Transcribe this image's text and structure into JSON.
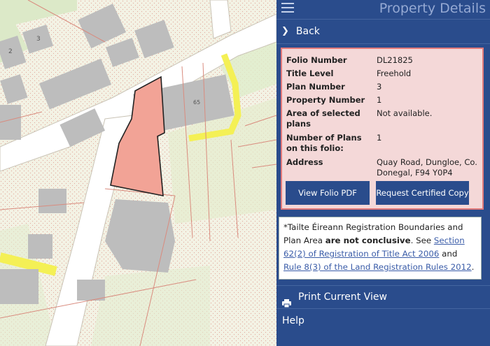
{
  "header": {
    "title": "Property Details",
    "menu_icon": "hamburger-icon"
  },
  "nav": {
    "back_label": "Back",
    "back_icon": "chevron-right-icon"
  },
  "details": {
    "rows": [
      {
        "label": "Folio Number",
        "value": "DL21825"
      },
      {
        "label": "Title Level",
        "value": "Freehold"
      },
      {
        "label": "Plan Number",
        "value": "3"
      },
      {
        "label": "Property Number",
        "value": "1"
      },
      {
        "label": "Area of selected plans",
        "value": "Not available."
      },
      {
        "label": "Number of Plans on this folio:",
        "value": "1"
      },
      {
        "label": "Address",
        "value": "Quay Road, Dungloe, Co. Donegal, F94 Y0P4"
      }
    ],
    "view_pdf_label": "View Folio PDF",
    "certified_copy_label": "Request Certified Copy"
  },
  "notice": {
    "prefix": "*Tailte Éireann Registration Boundaries and Plan Area ",
    "bold": "are not conclusive",
    "mid1": ". See ",
    "link1": "Section 62(2) of Registration of Title Act 2006",
    "mid2": " and ",
    "link2": "Rule 8(3) of the Land Registration Rules 2012",
    "suffix": "."
  },
  "actions": {
    "print_label": "Print Current View",
    "print_icon": "printer-icon",
    "help_label": "Help"
  },
  "map": {
    "labels": [
      "2",
      "3",
      "65"
    ],
    "selected_color": "#f2a396",
    "road_color": "#f4f055",
    "boundary_color": "#d98b7e"
  }
}
